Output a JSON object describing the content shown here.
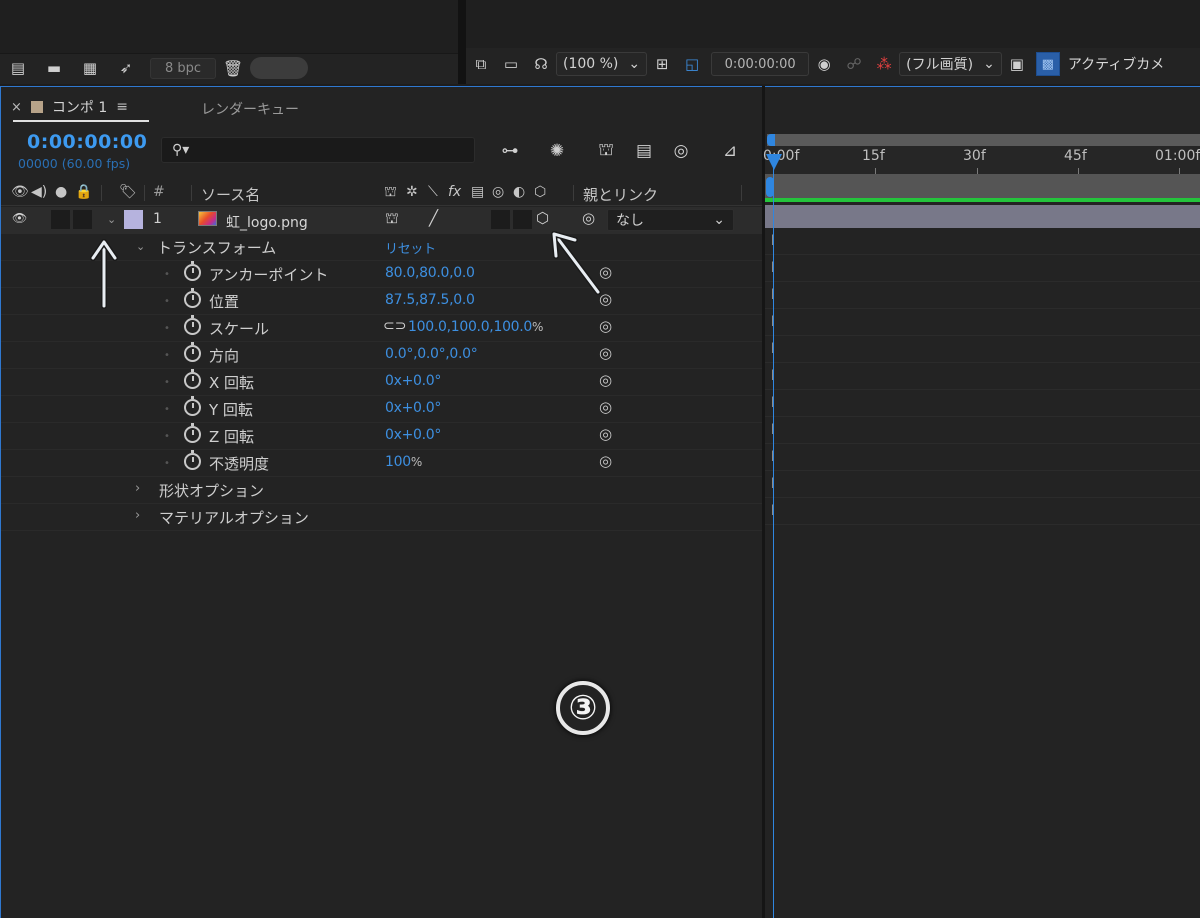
{
  "project_toolbar": {
    "bpc": "8 bpc"
  },
  "viewer_toolbar": {
    "zoom": "(100 %)",
    "timecode": "0:00:00:00",
    "quality": "(フル画質)",
    "active_camera": "アクティブカメ"
  },
  "comp": {
    "tab_label": "コンポ 1",
    "tab_render": "レンダーキュー",
    "timecode": "0:00:00:00",
    "framecode": "00000 (60.00 fps)",
    "search_icon": "search-icon"
  },
  "columns": {
    "number": "#",
    "source_name": "ソース名",
    "parent": "親とリンク",
    "fx": "fx"
  },
  "layer": {
    "number": "1",
    "name": "虹_logo.png",
    "parent_value": "なし"
  },
  "transform": {
    "label": "トランスフォーム",
    "reset": "リセット",
    "properties": [
      {
        "name": "アンカーポイント",
        "value": "80.0,80.0,0.0",
        "unit": ""
      },
      {
        "name": "位置",
        "value": "87.5,87.5,0.0",
        "unit": ""
      },
      {
        "name": "スケール",
        "value": "100.0,100.0,100.0",
        "unit": "%"
      },
      {
        "name": "方向",
        "value": "0.0°,0.0°,0.0°",
        "unit": ""
      },
      {
        "name": "X 回転",
        "value": "0x+0.0°",
        "unit": ""
      },
      {
        "name": "Y 回転",
        "value": "0x+0.0°",
        "unit": ""
      },
      {
        "name": "Z 回転",
        "value": "0x+0.0°",
        "unit": ""
      },
      {
        "name": "不透明度",
        "value": "100",
        "unit": "%"
      }
    ]
  },
  "groups": {
    "geometry": "形状オプション",
    "material": "マテリアルオプション"
  },
  "timeline": {
    "ruler": [
      "0:00f",
      "15f",
      "30f",
      "45f",
      "01:00f"
    ]
  },
  "annotation": {
    "step": "③"
  },
  "colors": {
    "accent": "#3d8fe0",
    "label_lavender": "#b6b3de",
    "green_bar": "#24c43c"
  }
}
